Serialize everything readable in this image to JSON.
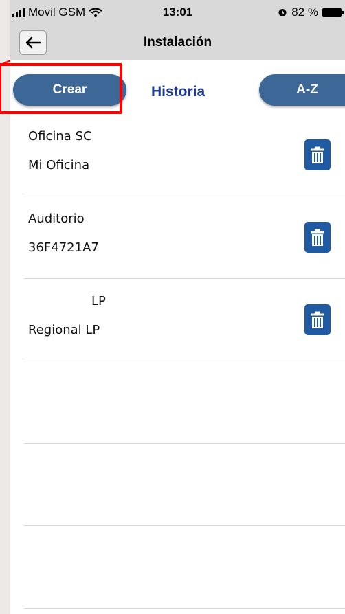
{
  "status_bar": {
    "carrier": "Movil GSM",
    "time": "13:01",
    "battery": "82 %"
  },
  "nav": {
    "title": "Instalación"
  },
  "tabs": {
    "create": "Crear",
    "history": "Historia",
    "sort": "A-Z"
  },
  "items": [
    {
      "name": "Oficina SC",
      "sub": "Mi Oficina"
    },
    {
      "name": "Auditorio",
      "sub": "36F4721A7"
    },
    {
      "name": "LP",
      "sub": "Regional LP"
    }
  ],
  "colors": {
    "accent": "#3c6797",
    "delete": "#1f5aa3",
    "tab_active": "#1e3c96",
    "highlight": "#ff0000"
  }
}
